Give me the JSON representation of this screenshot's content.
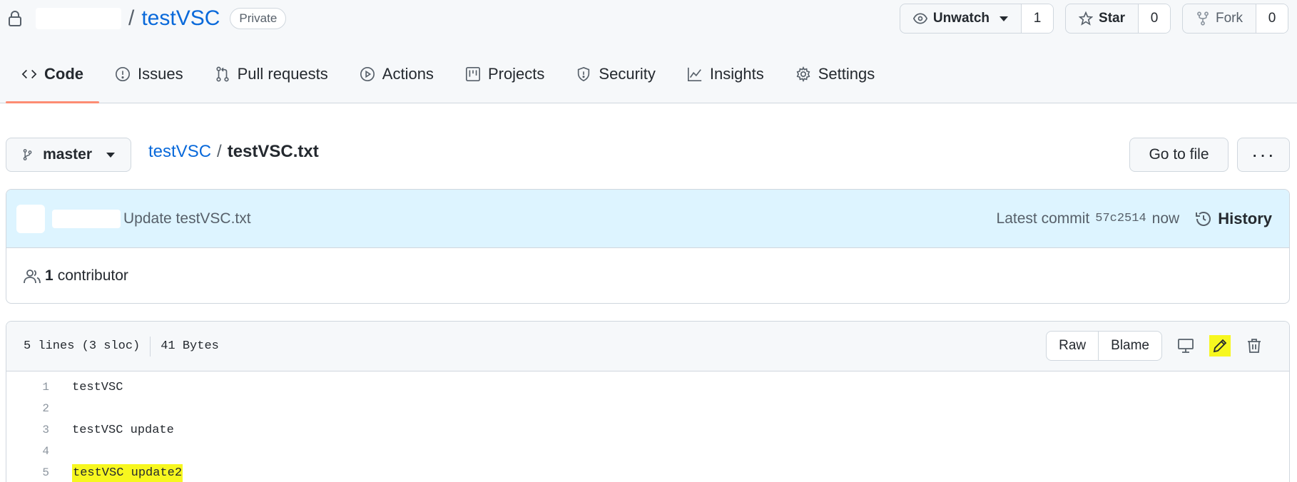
{
  "repo": {
    "name": "testVSC",
    "visibility": "Private"
  },
  "header_actions": {
    "watch": {
      "label": "Unwatch",
      "count": "1"
    },
    "star": {
      "label": "Star",
      "count": "0"
    },
    "fork": {
      "label": "Fork",
      "count": "0"
    }
  },
  "tabs": [
    {
      "label": "Code",
      "icon": "code-icon",
      "active": true
    },
    {
      "label": "Issues",
      "icon": "issue-icon"
    },
    {
      "label": "Pull requests",
      "icon": "pull-request-icon"
    },
    {
      "label": "Actions",
      "icon": "play-icon"
    },
    {
      "label": "Projects",
      "icon": "project-icon"
    },
    {
      "label": "Security",
      "icon": "shield-icon"
    },
    {
      "label": "Insights",
      "icon": "graph-icon"
    },
    {
      "label": "Settings",
      "icon": "gear-icon"
    }
  ],
  "file_nav": {
    "branch": "master",
    "breadcrumb_root": "testVSC",
    "breadcrumb_sep": "/",
    "file_name": "testVSC.txt",
    "goto_label": "Go to file",
    "more_label": "···"
  },
  "commit": {
    "message": "Update testVSC.txt",
    "latest_label": "Latest commit",
    "sha": "57c2514",
    "time": "now",
    "history_label": "History"
  },
  "contributors": {
    "count": "1",
    "label": "contributor"
  },
  "file_info": {
    "lines": "5 lines (3 sloc)",
    "size": "41 Bytes",
    "raw_label": "Raw",
    "blame_label": "Blame"
  },
  "code_lines": [
    {
      "num": "1",
      "text": "testVSC"
    },
    {
      "num": "2",
      "text": ""
    },
    {
      "num": "3",
      "text": "testVSC update"
    },
    {
      "num": "4",
      "text": ""
    },
    {
      "num": "5",
      "text": "testVSC update2",
      "highlighted": true
    }
  ],
  "colors": {
    "link": "#0969da",
    "active_tab_underline": "#fd8c73",
    "commit_bg": "#ddf4ff",
    "highlight": "#f7f71f"
  }
}
